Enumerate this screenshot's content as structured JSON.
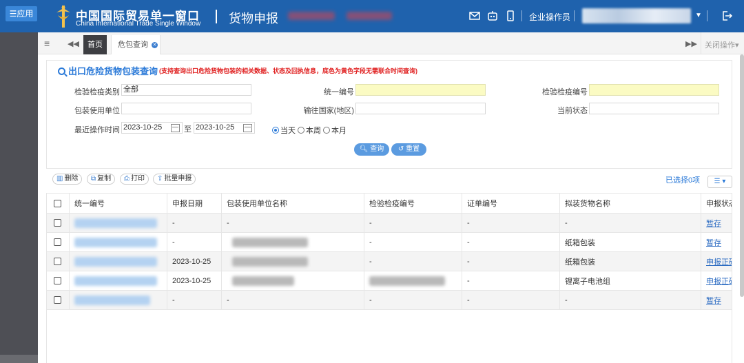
{
  "header": {
    "app_button": "☰应用",
    "brand_cn": "中国国际贸易单一窗口",
    "brand_en": "China International Trade Single Window",
    "module_title": "货物申报",
    "user_role": "企业操作员"
  },
  "tabs": {
    "home": "首页",
    "current": "危包查询",
    "close_ops": "关闭操作▾"
  },
  "query": {
    "title": "出口危险货物包装查询",
    "note": "(支持查询出口危险货物包装的相关数据、状态及回执信息，底色为黄色字段无需联合时间查询)",
    "labels": {
      "inspection_type": "检验检疫类别",
      "unified_no": "统一编号",
      "inspection_no": "检验检疫编号",
      "package_unit": "包装使用单位",
      "destination": "输往国家(地区)",
      "current_status": "当前状态",
      "recent_time": "最近操作时间",
      "to": "至"
    },
    "values": {
      "inspection_type": "全部",
      "date_from": "2023-10-25",
      "date_to": "2023-10-25"
    },
    "radios": [
      "当天",
      "本周",
      "本月"
    ],
    "radio_selected": "当天",
    "buttons": {
      "search": "查询",
      "reset": "重置"
    }
  },
  "toolbar": {
    "delete": "删除",
    "copy": "复制",
    "print": "打印",
    "batch_declare": "批量申报",
    "selected_count": "已选择0项",
    "columns_icon": "list-icon"
  },
  "table": {
    "columns": [
      "统一编号",
      "申报日期",
      "包装使用单位名称",
      "检验检疫编号",
      "证单编号",
      "拟装货物名称",
      "申报状态"
    ],
    "rows": [
      {
        "declare_date": "-",
        "unit_name": "-",
        "inspection_no": "-",
        "cert_no": "-",
        "goods_name": "-",
        "status": "暂存"
      },
      {
        "declare_date": "-",
        "unit_name": "",
        "inspection_no": "-",
        "cert_no": "-",
        "goods_name": "纸箱包装",
        "status": "暂存"
      },
      {
        "declare_date": "2023-10-25",
        "unit_name": "",
        "inspection_no": "-",
        "cert_no": "-",
        "goods_name": "纸箱包装",
        "status": "申报正确"
      },
      {
        "declare_date": "2023-10-25",
        "unit_name": "",
        "inspection_no": "",
        "cert_no": "-",
        "goods_name": "锂离子电池组",
        "status": "申报正确"
      },
      {
        "declare_date": "-",
        "unit_name": "-",
        "inspection_no": "-",
        "cert_no": "-",
        "goods_name": "-",
        "status": "暂存"
      }
    ]
  },
  "colors": {
    "header_bg": "#1f62ad",
    "accent": "#2b7ad8",
    "required_yellow": "#fbfbc3",
    "note_red": "#e02020"
  }
}
